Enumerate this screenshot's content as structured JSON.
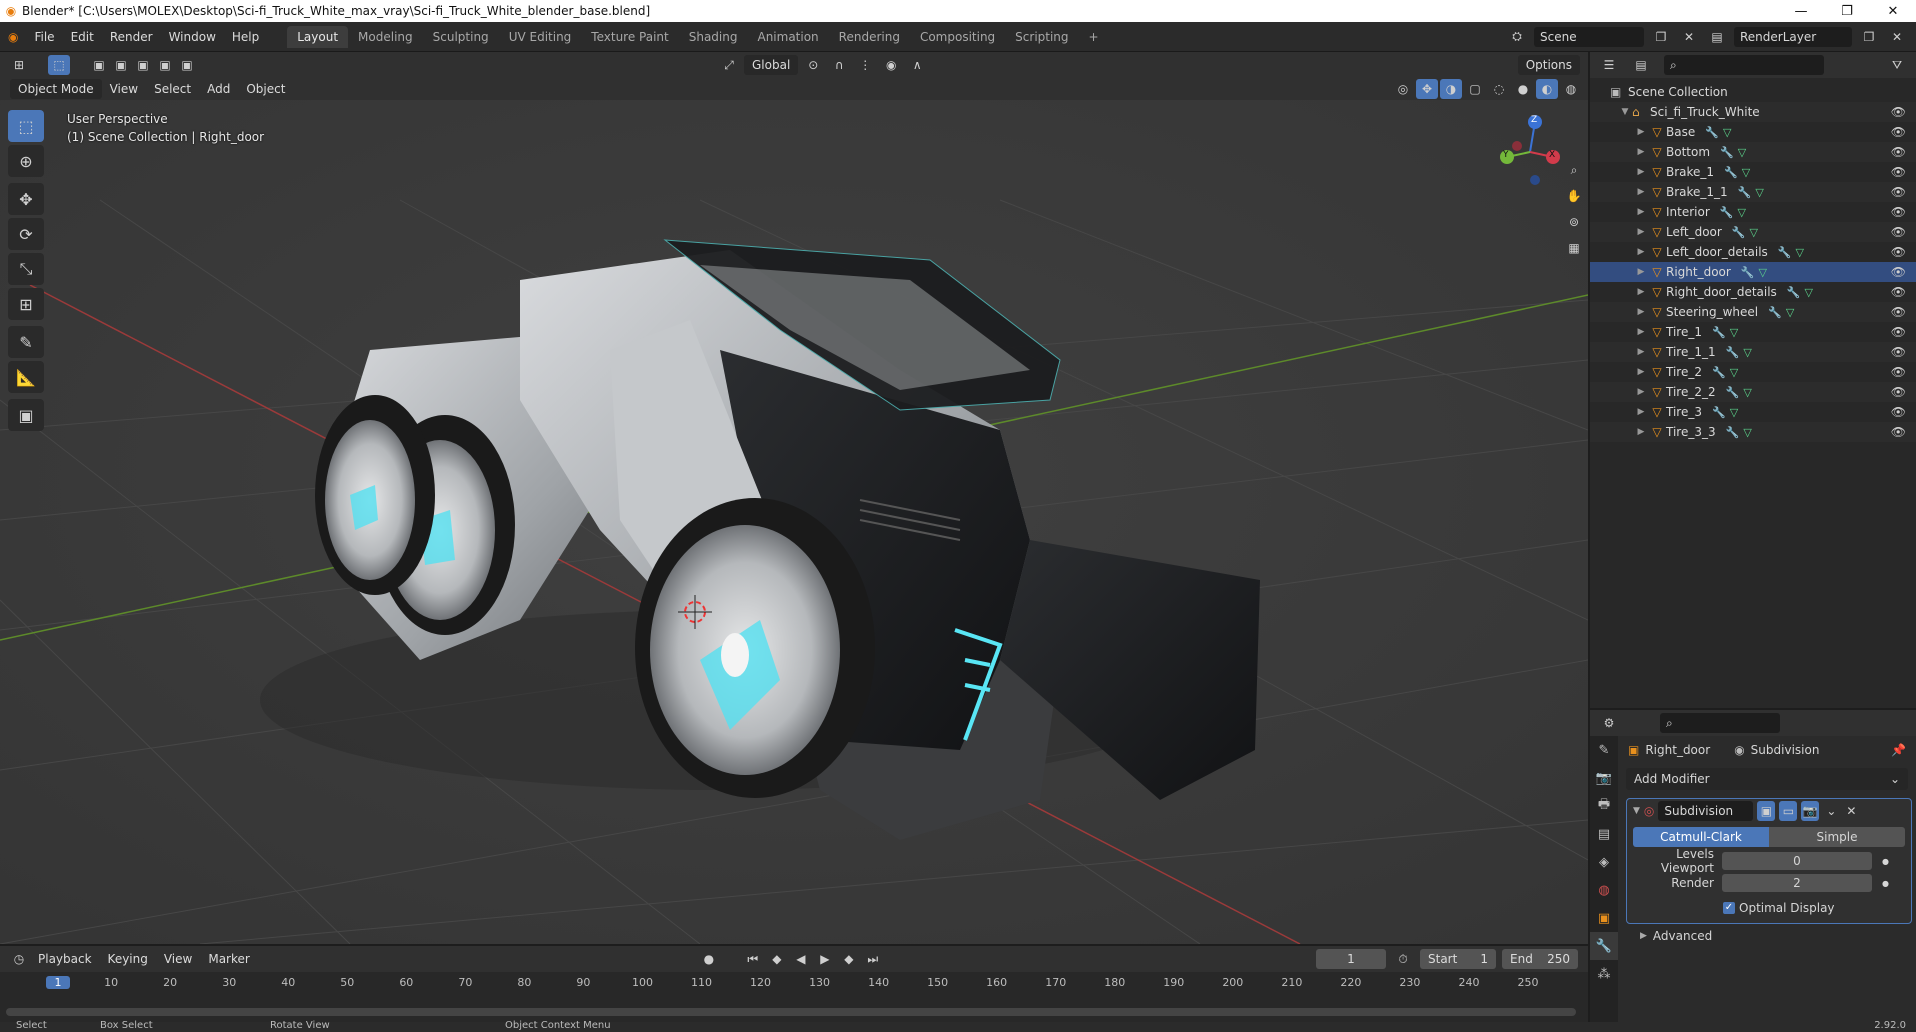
{
  "window": {
    "title": "Blender* [C:\\Users\\MOLEX\\Desktop\\Sci-fi_Truck_White_max_vray\\Sci-fi_Truck_White_blender_base.blend]",
    "controls": [
      "—",
      "❐",
      "✕"
    ]
  },
  "menu": [
    "File",
    "Edit",
    "Render",
    "Window",
    "Help"
  ],
  "workspaces": [
    "Layout",
    "Modeling",
    "Sculpting",
    "UV Editing",
    "Texture Paint",
    "Shading",
    "Animation",
    "Rendering",
    "Compositing",
    "Scripting"
  ],
  "active_workspace": "Layout",
  "scene": {
    "name": "Scene",
    "render_layer": "RenderLayer"
  },
  "viewport": {
    "orientation": "Global",
    "options_label": "Options",
    "mode": "Object Mode",
    "header_menu": [
      "View",
      "Select",
      "Add",
      "Object"
    ],
    "overlay_title": "User Perspective",
    "overlay_subtitle": "(1) Scene Collection | Right_door",
    "gizmo_axes": [
      "Z",
      "Y",
      "X"
    ]
  },
  "outliner": {
    "root": "Scene Collection",
    "collection": "Sci_fi_Truck_White",
    "objects": [
      "Base",
      "Bottom",
      "Brake_1",
      "Brake_1_1",
      "Interior",
      "Left_door",
      "Left_door_details",
      "Right_door",
      "Right_door_details",
      "Steering_wheel",
      "Tire_1",
      "Tire_1_1",
      "Tire_2",
      "Tire_2_2",
      "Tire_3",
      "Tire_3_3"
    ],
    "selected": "Right_door"
  },
  "properties": {
    "object_name": "Right_door",
    "modifier_context": "Subdivision",
    "add_modifier": "Add Modifier",
    "modifier_name": "Subdivision",
    "algo_options": [
      "Catmull-Clark",
      "Simple"
    ],
    "algo_selected": "Catmull-Clark",
    "levels_viewport_label": "Levels Viewport",
    "levels_viewport_value": "0",
    "render_label": "Render",
    "render_value": "2",
    "optimal_display_label": "Optimal Display",
    "optimal_display_checked": true,
    "advanced_label": "Advanced"
  },
  "timeline": {
    "menu": [
      "Playback",
      "Keying",
      "View",
      "Marker"
    ],
    "current_frame": "1",
    "start_label": "Start",
    "start_value": "1",
    "end_label": "End",
    "end_value": "250",
    "ticks": [
      "1",
      "10",
      "20",
      "30",
      "40",
      "50",
      "60",
      "70",
      "80",
      "90",
      "100",
      "110",
      "120",
      "130",
      "140",
      "150",
      "160",
      "170",
      "180",
      "190",
      "200",
      "210",
      "220",
      "230",
      "240",
      "250"
    ]
  },
  "statusbar": {
    "items": [
      "Select",
      "Box Select",
      "Rotate View",
      "Object Context Menu"
    ],
    "version": "2.92.0"
  },
  "colors": {
    "accent": "#4b77b8",
    "object_orange": "#e8901d",
    "viewport_bg": "#3a3a3a"
  }
}
